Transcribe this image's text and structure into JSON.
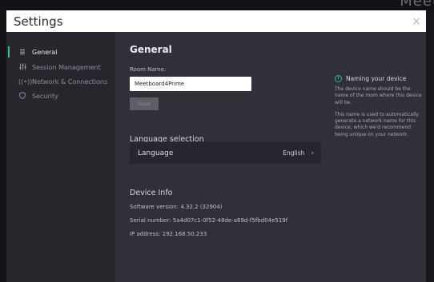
{
  "background": {
    "app_word": "Meet"
  },
  "window": {
    "title": "Settings",
    "close_glyph": "×"
  },
  "sidebar": {
    "items": [
      {
        "label": "General",
        "icon": "list-icon",
        "active": true
      },
      {
        "label": "Session Management",
        "icon": "sliders-icon",
        "active": false
      },
      {
        "label": "Network & Connections",
        "icon": "wireless-icon",
        "active": false
      },
      {
        "label": "Security",
        "icon": "shield-icon",
        "active": false
      }
    ]
  },
  "main": {
    "heading": "General",
    "room_name_label": "Room Name:",
    "room_name_value": "Meetboard4Prime",
    "save_label": "Save",
    "language_section": "Language selection",
    "language_label": "Language",
    "language_value": "English",
    "device_info_title": "Device Info",
    "software_version_label": "Software version:",
    "software_version": "4.32.2 (32904)",
    "serial_number_label": "Serial number:",
    "serial_number": "5a4d07c1-0f52-48de-a69d-f5fbd04e519f",
    "ip_address_label": "IP address:",
    "ip_address": "192.168.50.233"
  },
  "info_panel": {
    "title": "Naming your device",
    "p1": "The device name should be the name of the room where this device will be.",
    "p2": "This name is used to automatically generate a network name for this device; which we'd recommend being unique on your network."
  },
  "colors": {
    "accent": "#2fb5a3",
    "sidebar_bg": "#26262c",
    "main_bg": "#2f3038"
  }
}
